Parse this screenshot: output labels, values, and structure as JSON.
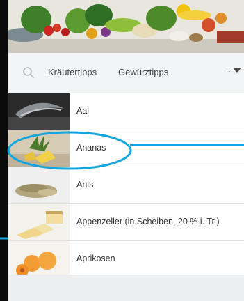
{
  "toolbar": {
    "tabs": [
      {
        "label": "Kräutertipps"
      },
      {
        "label": "Gewürztipps"
      }
    ],
    "more_label": ".."
  },
  "list": {
    "items": [
      {
        "label": "Aal"
      },
      {
        "label": "Ananas"
      },
      {
        "label": "Anis"
      },
      {
        "label": "Appenzeller (in Scheiben, 20 % i. Tr.)"
      },
      {
        "label": "Aprikosen"
      }
    ]
  },
  "colors": {
    "annotation": "#12a6df",
    "toolbar_bg": "#f3f4f6",
    "text": "#333333"
  },
  "icons": [
    "search-icon",
    "chevron-down-icon"
  ]
}
